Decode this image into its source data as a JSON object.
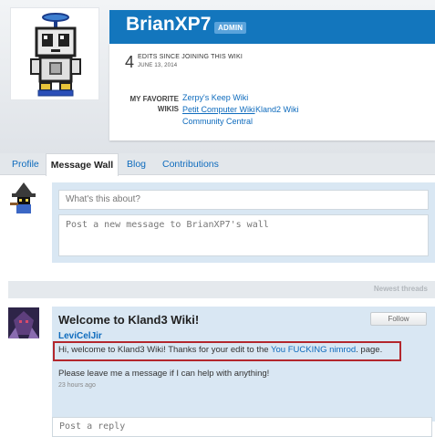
{
  "profile": {
    "user_name": "BrianXP7",
    "badge": "ADMIN",
    "edit_count": "4",
    "edits_label": "EDITS SINCE JOINING THIS WIKI",
    "join_date": "JUNE 13, 2014",
    "favorite_wikis_label": "MY FAVORITE WIKIS",
    "favorite_wikis": [
      "Zerpy's Keep Wiki",
      "Petit Computer Wiki",
      "Kland2 Wiki",
      "Community Central"
    ]
  },
  "tabs": [
    {
      "label": "Profile",
      "active": false
    },
    {
      "label": "Message Wall",
      "active": true
    },
    {
      "label": "Blog",
      "active": false
    },
    {
      "label": "Contributions",
      "active": false
    }
  ],
  "new_message": {
    "title_placeholder": "What's this about?",
    "body_placeholder": "Post a new message to BrianXP7's wall"
  },
  "threads_sort": "Newest threads",
  "thread": {
    "title": "Welcome to Kland3 Wiki!",
    "follow_label": "Follow",
    "author": "LeviCelJir",
    "message_part1": "Hi, welcome to Kland3 Wiki! Thanks for your edit to the ",
    "message_link": "You FUCKING nimrod",
    "message_part2": ". page.",
    "message_line2": "Please leave me a message if I can help with anything!",
    "timestamp": "23 hours ago",
    "reply_placeholder": "Post a reply"
  },
  "colors": {
    "accent": "#1376bd",
    "link": "#0e6bbd",
    "panel": "#d9e7f3",
    "highlight_border": "#b3272d"
  }
}
